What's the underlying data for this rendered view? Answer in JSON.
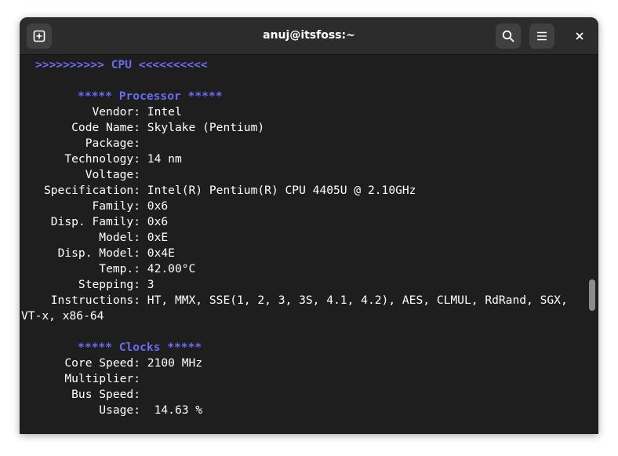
{
  "window": {
    "title": "anuj@itsfoss:~"
  },
  "icons": {
    "new_tab": "plus-square-icon",
    "search": "search-icon",
    "menu": "hamburger-menu-icon",
    "close": "close-icon"
  },
  "colors": {
    "terminal_bg": "#1e1e1e",
    "titlebar_bg": "#2c2c2c",
    "header_text": "#6b6bf5",
    "text": "#ffffff"
  },
  "terminal": {
    "section_banner": ">>>>>>>>>> CPU <<<<<<<<<<",
    "processor_header": "***** Processor *****",
    "processor": [
      {
        "label": "Vendor:",
        "value": "Intel"
      },
      {
        "label": "Code Name:",
        "value": "Skylake (Pentium)"
      },
      {
        "label": "Package:",
        "value": ""
      },
      {
        "label": "Technology:",
        "value": "14 nm"
      },
      {
        "label": "Voltage:",
        "value": ""
      },
      {
        "label": "Specification:",
        "value": "Intel(R) Pentium(R) CPU 4405U @ 2.10GHz"
      },
      {
        "label": "Family:",
        "value": "0x6"
      },
      {
        "label": "Disp. Family:",
        "value": "0x6"
      },
      {
        "label": "Model:",
        "value": "0xE"
      },
      {
        "label": "Disp. Model:",
        "value": "0x4E"
      },
      {
        "label": "Temp.:",
        "value": "42.00°C"
      },
      {
        "label": "Stepping:",
        "value": "3"
      },
      {
        "label": "Instructions:",
        "value": "HT, MMX, SSE(1, 2, 3, 3S, 4.1, 4.2), AES, CLMUL, RdRand, SGX,"
      }
    ],
    "instructions_wrap": "VT-x, x86-64",
    "clocks_header": "***** Clocks *****",
    "clocks": [
      {
        "label": "Core Speed:",
        "value": "2100 MHz"
      },
      {
        "label": "Multiplier:",
        "value": ""
      },
      {
        "label": "Bus Speed:",
        "value": ""
      },
      {
        "label": "Usage:",
        "value": " 14.63 %"
      }
    ]
  }
}
